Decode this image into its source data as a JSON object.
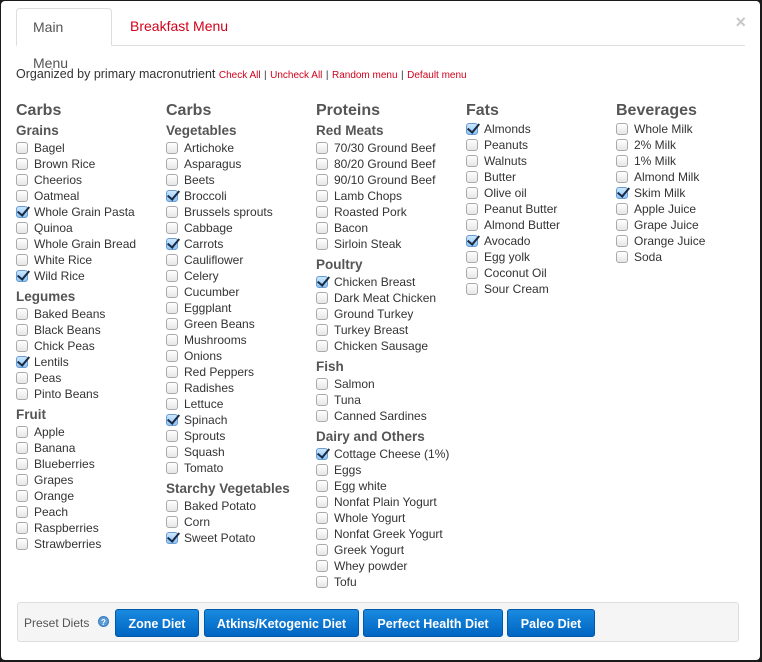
{
  "tabs": [
    {
      "label": "Main Menu",
      "active": true
    },
    {
      "label": "Breakfast Menu",
      "active": false
    }
  ],
  "close_icon": "×",
  "intro": {
    "text": "Organized by primary macronutrient",
    "links": [
      "Check All",
      "Uncheck All",
      "Random menu",
      "Default menu"
    ],
    "separator": "|"
  },
  "columns": [
    {
      "title": "Carbs",
      "groups": [
        {
          "name": "Grains",
          "items": [
            {
              "label": "Bagel",
              "checked": false
            },
            {
              "label": "Brown Rice",
              "checked": false
            },
            {
              "label": "Cheerios",
              "checked": false
            },
            {
              "label": "Oatmeal",
              "checked": false
            },
            {
              "label": "Whole Grain Pasta",
              "checked": true
            },
            {
              "label": "Quinoa",
              "checked": false
            },
            {
              "label": "Whole Grain Bread",
              "checked": false
            },
            {
              "label": "White Rice",
              "checked": false
            },
            {
              "label": "Wild Rice",
              "checked": true
            }
          ]
        },
        {
          "name": "Legumes",
          "items": [
            {
              "label": "Baked Beans",
              "checked": false
            },
            {
              "label": "Black Beans",
              "checked": false
            },
            {
              "label": "Chick Peas",
              "checked": false
            },
            {
              "label": "Lentils",
              "checked": true
            },
            {
              "label": "Peas",
              "checked": false
            },
            {
              "label": "Pinto Beans",
              "checked": false
            }
          ]
        },
        {
          "name": "Fruit",
          "items": [
            {
              "label": "Apple",
              "checked": false
            },
            {
              "label": "Banana",
              "checked": false
            },
            {
              "label": "Blueberries",
              "checked": false
            },
            {
              "label": "Grapes",
              "checked": false
            },
            {
              "label": "Orange",
              "checked": false
            },
            {
              "label": "Peach",
              "checked": false
            },
            {
              "label": "Raspberries",
              "checked": false
            },
            {
              "label": "Strawberries",
              "checked": false
            }
          ]
        }
      ]
    },
    {
      "title": "Carbs",
      "groups": [
        {
          "name": "Vegetables",
          "items": [
            {
              "label": "Artichoke",
              "checked": false
            },
            {
              "label": "Asparagus",
              "checked": false
            },
            {
              "label": "Beets",
              "checked": false
            },
            {
              "label": "Broccoli",
              "checked": true
            },
            {
              "label": "Brussels sprouts",
              "checked": false
            },
            {
              "label": "Cabbage",
              "checked": false
            },
            {
              "label": "Carrots",
              "checked": true
            },
            {
              "label": "Cauliflower",
              "checked": false
            },
            {
              "label": "Celery",
              "checked": false
            },
            {
              "label": "Cucumber",
              "checked": false
            },
            {
              "label": "Eggplant",
              "checked": false
            },
            {
              "label": "Green Beans",
              "checked": false
            },
            {
              "label": "Mushrooms",
              "checked": false
            },
            {
              "label": "Onions",
              "checked": false
            },
            {
              "label": "Red Peppers",
              "checked": false
            },
            {
              "label": "Radishes",
              "checked": false
            },
            {
              "label": "Lettuce",
              "checked": false
            },
            {
              "label": "Spinach",
              "checked": true
            },
            {
              "label": "Sprouts",
              "checked": false
            },
            {
              "label": "Squash",
              "checked": false
            },
            {
              "label": "Tomato",
              "checked": false
            }
          ]
        },
        {
          "name": "Starchy Vegetables",
          "items": [
            {
              "label": "Baked Potato",
              "checked": false
            },
            {
              "label": "Corn",
              "checked": false
            },
            {
              "label": "Sweet Potato",
              "checked": true
            }
          ]
        }
      ]
    },
    {
      "title": "Proteins",
      "groups": [
        {
          "name": "Red Meats",
          "items": [
            {
              "label": "70/30 Ground Beef",
              "checked": false
            },
            {
              "label": "80/20 Ground Beef",
              "checked": false
            },
            {
              "label": "90/10 Ground Beef",
              "checked": false
            },
            {
              "label": "Lamb Chops",
              "checked": false
            },
            {
              "label": "Roasted Pork",
              "checked": false
            },
            {
              "label": "Bacon",
              "checked": false
            },
            {
              "label": "Sirloin Steak",
              "checked": false
            }
          ]
        },
        {
          "name": "Poultry",
          "items": [
            {
              "label": "Chicken Breast",
              "checked": true
            },
            {
              "label": "Dark Meat Chicken",
              "checked": false
            },
            {
              "label": "Ground Turkey",
              "checked": false
            },
            {
              "label": "Turkey Breast",
              "checked": false
            },
            {
              "label": "Chicken Sausage",
              "checked": false
            }
          ]
        },
        {
          "name": "Fish",
          "items": [
            {
              "label": "Salmon",
              "checked": false
            },
            {
              "label": "Tuna",
              "checked": false
            },
            {
              "label": "Canned Sardines",
              "checked": false
            }
          ]
        },
        {
          "name": "Dairy and Others",
          "items": [
            {
              "label": "Cottage Cheese (1%)",
              "checked": true
            },
            {
              "label": "Eggs",
              "checked": false
            },
            {
              "label": "Egg white",
              "checked": false
            },
            {
              "label": "Nonfat Plain Yogurt",
              "checked": false
            },
            {
              "label": "Whole Yogurt",
              "checked": false
            },
            {
              "label": "Nonfat Greek Yogurt",
              "checked": false
            },
            {
              "label": "Greek Yogurt",
              "checked": false
            },
            {
              "label": "Whey powder",
              "checked": false
            },
            {
              "label": "Tofu",
              "checked": false
            }
          ]
        }
      ]
    },
    {
      "title": "Fats",
      "groups": [
        {
          "name": "",
          "items": [
            {
              "label": "Almonds",
              "checked": true
            },
            {
              "label": "Peanuts",
              "checked": false
            },
            {
              "label": "Walnuts",
              "checked": false
            },
            {
              "label": "Butter",
              "checked": false
            },
            {
              "label": "Olive oil",
              "checked": false
            },
            {
              "label": "Peanut Butter",
              "checked": false
            },
            {
              "label": "Almond Butter",
              "checked": false
            },
            {
              "label": "Avocado",
              "checked": true
            },
            {
              "label": "Egg yolk",
              "checked": false
            },
            {
              "label": "Coconut Oil",
              "checked": false
            },
            {
              "label": "Sour Cream",
              "checked": false
            }
          ]
        }
      ]
    },
    {
      "title": "Beverages",
      "groups": [
        {
          "name": "",
          "items": [
            {
              "label": "Whole Milk",
              "checked": false
            },
            {
              "label": "2% Milk",
              "checked": false
            },
            {
              "label": "1% Milk",
              "checked": false
            },
            {
              "label": "Almond Milk",
              "checked": false
            },
            {
              "label": "Skim Milk",
              "checked": true
            },
            {
              "label": "Apple Juice",
              "checked": false
            },
            {
              "label": "Grape Juice",
              "checked": false
            },
            {
              "label": "Orange Juice",
              "checked": false
            },
            {
              "label": "Soda",
              "checked": false
            }
          ]
        }
      ]
    }
  ],
  "preset": {
    "label": "Preset Diets",
    "help_icon": "?",
    "buttons": [
      "Zone Diet",
      "Atkins/Ketogenic Diet",
      "Perfect Health Diet",
      "Paleo Diet"
    ]
  }
}
